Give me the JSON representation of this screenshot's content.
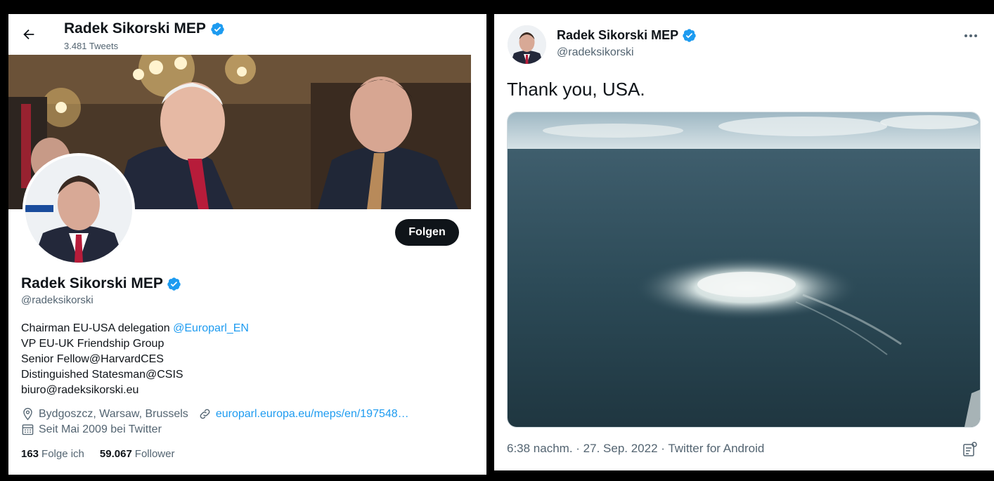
{
  "profile_header": {
    "name": "Radek Sikorski MEP",
    "tweet_count": "3.481 Tweets"
  },
  "profile": {
    "follow_label": "Folgen",
    "name": "Radek Sikorski MEP",
    "handle": "@radeksikorski",
    "bio": {
      "line1_text": "Chairman EU-USA delegation ",
      "line1_link": "@Europarl_EN",
      "line2": "VP EU-UK Friendship Group",
      "line3": "Senior Fellow@HarvardCES",
      "line4": "Distinguished Statesman@CSIS",
      "line5": "biuro@radeksikorski.eu"
    },
    "location": "Bydgoszcz, Warsaw, Brussels",
    "website": "europarl.europa.eu/meps/en/197548…",
    "joined": "Seit Mai 2009 bei Twitter",
    "following_count": "163",
    "following_label": "Folge ich",
    "followers_count": "59.067",
    "followers_label": "Follower"
  },
  "tweet": {
    "name": "Radek Sikorski MEP",
    "handle": "@radeksikorski",
    "text": "Thank you, USA.",
    "meta": "6:38 nachm. · 27. Sep. 2022 · Twitter for Android"
  },
  "icons": {
    "back": "back-arrow-icon",
    "verified": "verified-badge-icon",
    "location": "location-pin-icon",
    "link": "link-icon",
    "calendar": "calendar-icon",
    "more": "more-dots-icon",
    "analytics": "analytics-icon"
  },
  "colors": {
    "accent": "#1d9bf0",
    "text": "#0f1419",
    "secondary": "#536471",
    "button": "#0f1419"
  }
}
